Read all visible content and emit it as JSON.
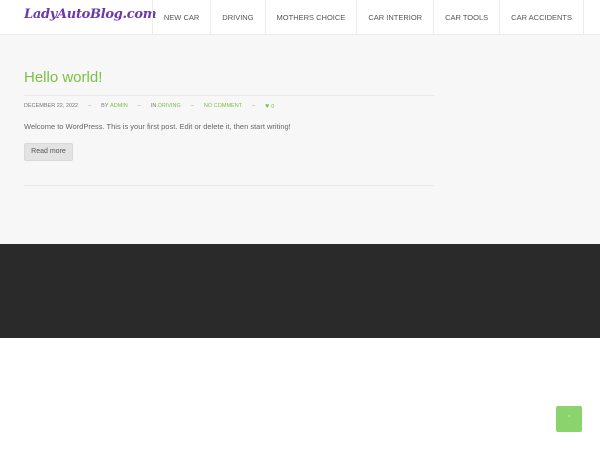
{
  "site": {
    "logo_text": "LadyAutoBlog.com"
  },
  "nav": {
    "items": [
      {
        "label": "NEW CAR"
      },
      {
        "label": "DRIVING"
      },
      {
        "label": "MOTHERS CHOICE"
      },
      {
        "label": "CAR INTERIOR"
      },
      {
        "label": "CAR TOOLS"
      },
      {
        "label": "CAR ACCIDENTS"
      }
    ]
  },
  "post": {
    "title": "Hello world!",
    "date": "DECEMBER 22, 2022",
    "separator": "–",
    "by_prefix": "BY",
    "author": "ADMIN",
    "in_prefix": "IN",
    "category": "DRIVING",
    "comments": "NO COMMENT",
    "likes": "0",
    "excerpt": "Welcome to WordPress. This is your first post. Edit or delete it, then start writing!",
    "read_more_label": "Read more"
  },
  "back_to_top": {
    "icon": "chevron-up-icon",
    "glyph": "ˆ"
  },
  "colors": {
    "accent": "#7ac143",
    "footer": "#2a2a2a",
    "back_to_top": "#8bd36c"
  }
}
